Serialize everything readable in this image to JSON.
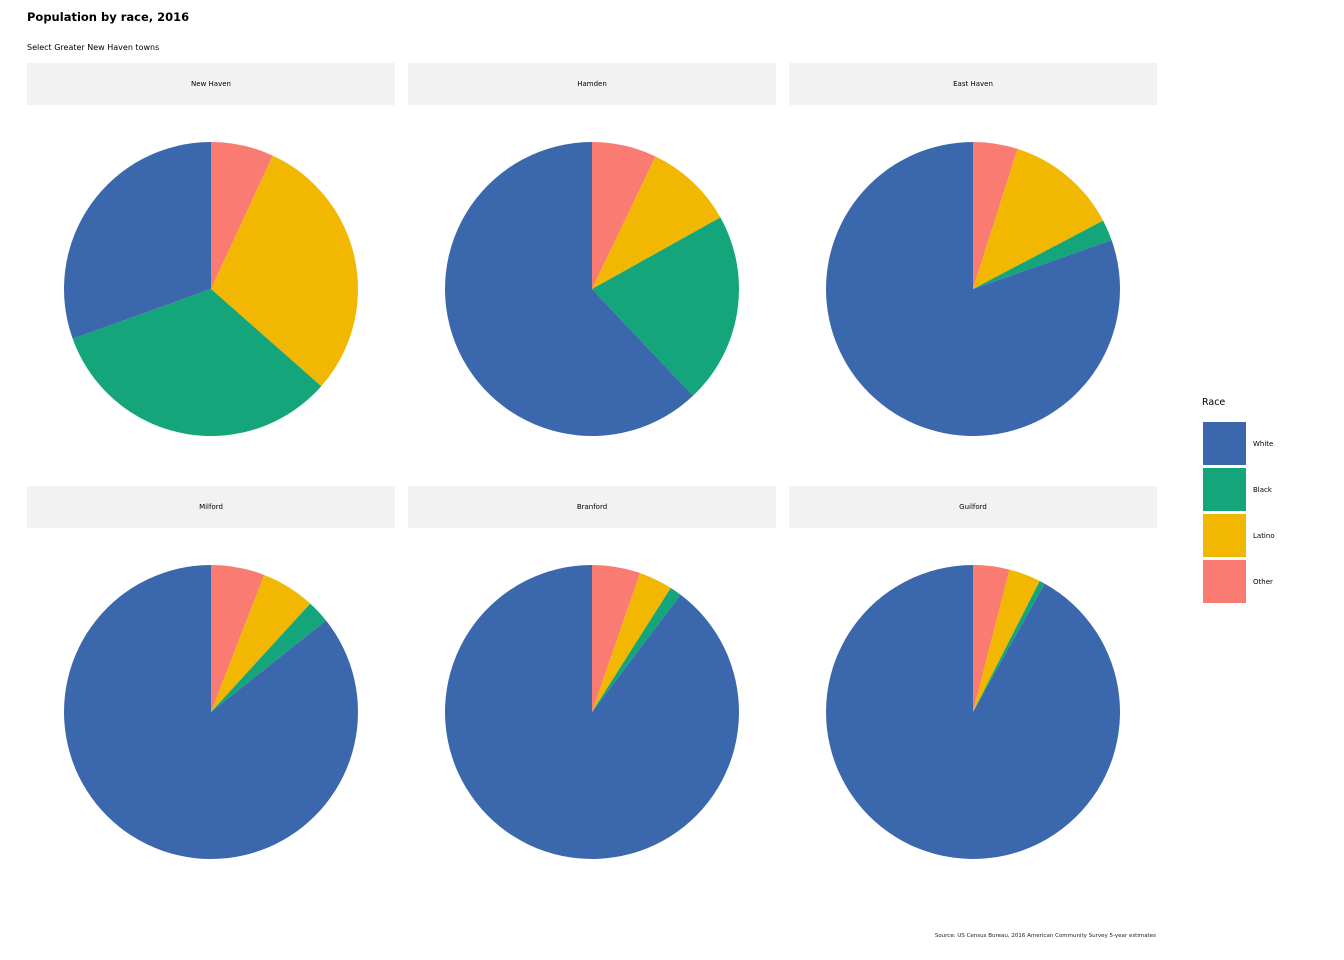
{
  "title": "Population by race, 2016",
  "subtitle": "Select Greater New Haven towns",
  "source": "Source: US Census Bureau, 2016 American Community Survey 5-year estimates",
  "legend": {
    "title": "Race",
    "items": [
      {
        "label": "White",
        "color": "#3b68ad"
      },
      {
        "label": "Black",
        "color": "#14a67a"
      },
      {
        "label": "Latino",
        "color": "#f2b700"
      },
      {
        "label": "Other",
        "color": "#f97b72"
      }
    ]
  },
  "chart_data": {
    "type": "pie",
    "series_order": [
      "Other",
      "Latino",
      "Black",
      "White"
    ],
    "facets": [
      {
        "name": "New Haven",
        "values": {
          "White": 30.5,
          "Black": 33.0,
          "Latino": 29.6,
          "Other": 6.9
        }
      },
      {
        "name": "Hamden",
        "values": {
          "White": 60.2,
          "Black": 20.4,
          "Latino": 9.5,
          "Other": 6.9
        }
      },
      {
        "name": "East Haven",
        "values": {
          "White": 80.4,
          "Black": 2.3,
          "Latino": 12.4,
          "Other": 4.9
        }
      },
      {
        "name": "Milford",
        "values": {
          "White": 85.7,
          "Black": 2.5,
          "Latino": 5.9,
          "Other": 5.9
        }
      },
      {
        "name": "Branford",
        "values": {
          "White": 89.7,
          "Black": 1.3,
          "Latino": 3.7,
          "Other": 5.3
        }
      },
      {
        "name": "Guilford",
        "values": {
          "White": 91.9,
          "Black": 0.6,
          "Latino": 3.5,
          "Other": 4.0
        }
      }
    ]
  }
}
